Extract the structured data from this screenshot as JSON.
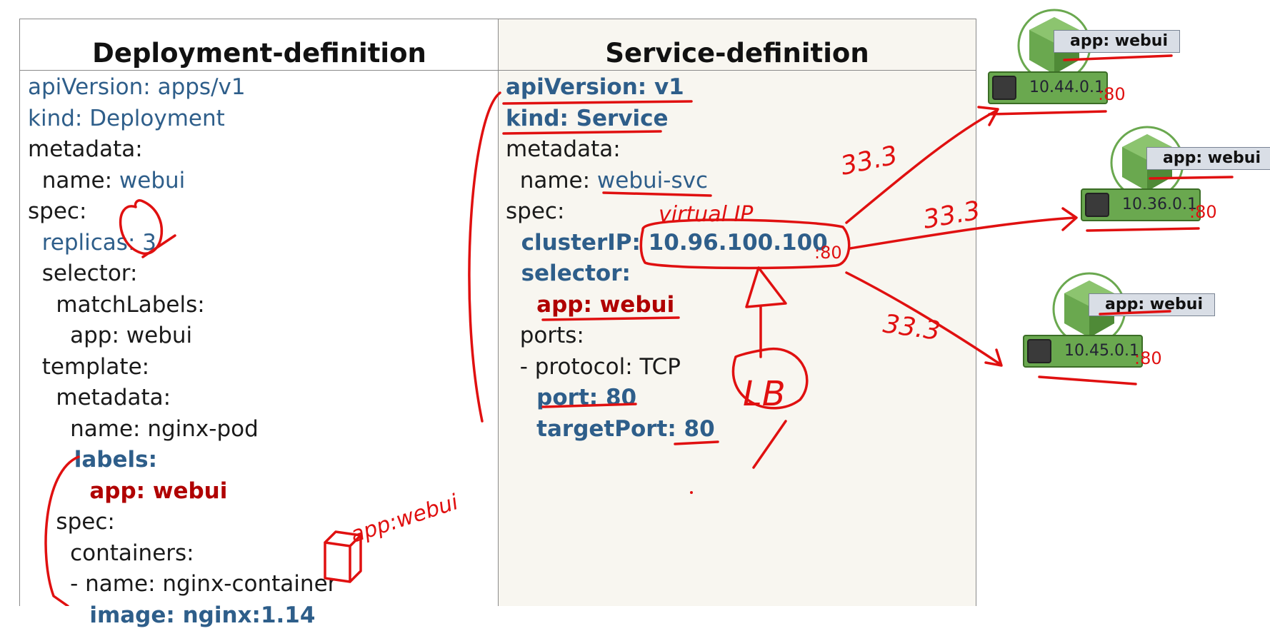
{
  "left": {
    "title": "Deployment-definition",
    "lines": [
      {
        "segs": [
          {
            "t": "apiVersion: apps/v1",
            "c": "blue"
          }
        ]
      },
      {
        "segs": [
          {
            "t": "kind: Deployment",
            "c": "blue"
          }
        ]
      },
      {
        "segs": [
          {
            "t": "metadata:",
            "c": "dark"
          }
        ]
      },
      {
        "segs": [
          {
            "t": "  name: ",
            "c": "dark"
          },
          {
            "t": "webui",
            "c": "blue"
          }
        ]
      },
      {
        "segs": [
          {
            "t": "spec:",
            "c": "dark"
          }
        ]
      },
      {
        "segs": [
          {
            "t": "  replicas: 3",
            "c": "blue"
          }
        ]
      },
      {
        "segs": [
          {
            "t": "  selector:",
            "c": "dark"
          }
        ]
      },
      {
        "segs": [
          {
            "t": "    matchLabels:",
            "c": "dark"
          }
        ]
      },
      {
        "segs": [
          {
            "t": "      app: webui",
            "c": "dark"
          }
        ]
      },
      {
        "segs": [
          {
            "t": "  template:",
            "c": "dark"
          }
        ]
      },
      {
        "segs": [
          {
            "t": "    metadata:",
            "c": "dark"
          }
        ]
      },
      {
        "segs": [
          {
            "t": "      name: nginx-pod",
            "c": "dark"
          }
        ]
      },
      {
        "segs": [
          {
            "t": "      labels:",
            "c": "bblue"
          }
        ]
      },
      {
        "segs": [
          {
            "t": "        app: webui",
            "c": "bred"
          }
        ]
      },
      {
        "segs": [
          {
            "t": "    spec:",
            "c": "dark"
          }
        ]
      },
      {
        "segs": [
          {
            "t": "      containers:",
            "c": "dark"
          }
        ]
      },
      {
        "segs": [
          {
            "t": "      - name: nginx-container",
            "c": "dark"
          }
        ]
      },
      {
        "segs": [
          {
            "t": "        image: nginx:1.14",
            "c": "bblue"
          }
        ]
      }
    ]
  },
  "right": {
    "title": "Service-definition",
    "lines": [
      {
        "segs": [
          {
            "t": "apiVersion: v1",
            "c": "bblue"
          }
        ]
      },
      {
        "segs": [
          {
            "t": "kind: Service",
            "c": "bblue"
          }
        ]
      },
      {
        "segs": [
          {
            "t": "metadata:",
            "c": "dark"
          }
        ]
      },
      {
        "segs": [
          {
            "t": "  name: ",
            "c": "dark"
          },
          {
            "t": "webui-svc",
            "c": "blue"
          }
        ]
      },
      {
        "segs": [
          {
            "t": "spec:",
            "c": "dark"
          }
        ]
      },
      {
        "segs": [
          {
            "t": "  clusterIP: 10.96.100.100",
            "c": "bblue"
          }
        ]
      },
      {
        "segs": [
          {
            "t": "  selector:",
            "c": "bblue"
          }
        ]
      },
      {
        "segs": [
          {
            "t": "    app: webui",
            "c": "bred"
          }
        ]
      },
      {
        "segs": [
          {
            "t": "  ports:",
            "c": "dark"
          }
        ]
      },
      {
        "segs": [
          {
            "t": "  - protocol: TCP",
            "c": "dark"
          }
        ]
      },
      {
        "segs": [
          {
            "t": "    port: 80",
            "c": "bblue"
          }
        ]
      },
      {
        "segs": [
          {
            "t": "    targetPort: 80",
            "c": "bblue"
          }
        ]
      }
    ]
  },
  "pods": [
    {
      "label": "app: webui",
      "ip": "10.44.0.1"
    },
    {
      "label": "app: webui",
      "ip": "10.36.0.1"
    },
    {
      "label": "app: webui",
      "ip": "10.45.0.1"
    }
  ],
  "annotations": {
    "weight_1": "33.3",
    "weight_2": "33.3",
    "weight_3": "33.3",
    "virtual_ip": "virtual IP",
    "lb": "LB",
    "pod_note": "app:webui",
    "port_80": ":80"
  },
  "colors": {
    "ink": "#e01010",
    "pod_green": "#6aa84f",
    "code_blue": "#2e5e8a",
    "code_red": "#b00000"
  }
}
